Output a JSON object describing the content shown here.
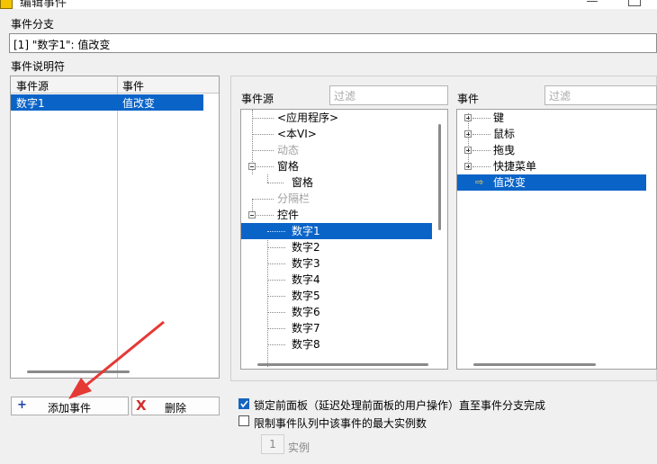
{
  "window": {
    "title": "编辑事件",
    "minimize_glyph": "—"
  },
  "event_case": {
    "label": "事件分支",
    "value": "[1] \"数字1\": 值改变"
  },
  "event_specifiers": {
    "label": "事件说明符",
    "columns": [
      "事件源",
      "事件"
    ],
    "rows": [
      {
        "source": "数字1",
        "event": "值改变",
        "selected": true
      }
    ]
  },
  "event_sources": {
    "label": "事件源",
    "filter_placeholder": "过滤",
    "items": [
      {
        "text": "<应用程序>",
        "enabled": true
      },
      {
        "text": "<本VI>",
        "enabled": true
      },
      {
        "text": "动态",
        "enabled": false
      },
      {
        "text": "窗格",
        "enabled": true
      },
      {
        "text": "窗格",
        "enabled": true
      },
      {
        "text": "分隔栏",
        "enabled": false
      },
      {
        "text": "控件",
        "enabled": true
      },
      {
        "text": "数字1",
        "enabled": true,
        "selected": true
      },
      {
        "text": "数字2",
        "enabled": true
      },
      {
        "text": "数字3",
        "enabled": true
      },
      {
        "text": "数字4",
        "enabled": true
      },
      {
        "text": "数字5",
        "enabled": true
      },
      {
        "text": "数字6",
        "enabled": true
      },
      {
        "text": "数字7",
        "enabled": true
      },
      {
        "text": "数字8",
        "enabled": true
      }
    ]
  },
  "events": {
    "label": "事件",
    "filter_placeholder": "过滤",
    "items": [
      {
        "text": "键"
      },
      {
        "text": "鼠标"
      },
      {
        "text": "拖曳"
      },
      {
        "text": "快捷菜单"
      },
      {
        "text": "值改变",
        "selected": true
      }
    ],
    "arrow_glyph": "⇨"
  },
  "buttons": {
    "add_event": {
      "label": "添加事件",
      "icon": "plus-icon",
      "glyph": "+"
    },
    "delete": {
      "label": "删除",
      "icon": "x-icon",
      "glyph": "X"
    }
  },
  "options": {
    "lock_front_panel": {
      "label": "锁定前面板（延迟处理前面板的用户操作）直至事件分支完成",
      "checked": true
    },
    "limit_queue": {
      "label": "限制事件队列中该事件的最大实例数",
      "checked": false
    },
    "instances": {
      "value": "1",
      "unit": "实例"
    }
  },
  "colors": {
    "selection": "#0a64c8",
    "annotation_arrow": "#e53935",
    "checkbox": "#1565c0"
  }
}
